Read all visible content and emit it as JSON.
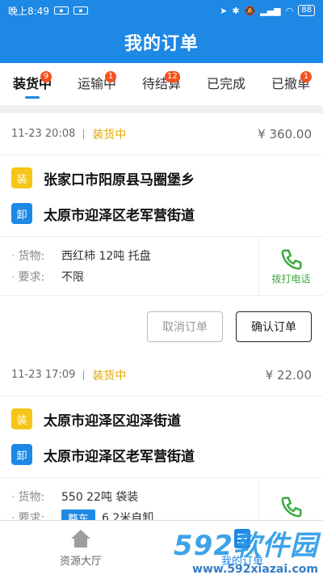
{
  "statusbar": {
    "time": "晚上8:49",
    "battery": "88"
  },
  "header": {
    "title": "我的订单"
  },
  "tabs": [
    {
      "label": "装货中",
      "badge": "9",
      "active": true
    },
    {
      "label": "运输中",
      "badge": "1",
      "active": false
    },
    {
      "label": "待结算",
      "badge": "12",
      "active": false
    },
    {
      "label": "已完成",
      "badge": "",
      "active": false
    },
    {
      "label": "已撤单",
      "badge": "1",
      "active": false
    }
  ],
  "orders": [
    {
      "datetime": "11-23 20:08",
      "state": "装货中",
      "price": "¥ 360.00",
      "load_tag": "装",
      "load_address": "张家口市阳原县马圈堡乡",
      "unload_tag": "卸",
      "unload_address": "太原市迎泽区老军营街道",
      "cargo_label": "货物:",
      "cargo": "西红柿 12吨 托盘",
      "req_label": "要求:",
      "requirement": "不限",
      "call_label": "拨打电话",
      "cancel_label": "取消订单",
      "confirm_label": "确认订单"
    },
    {
      "datetime": "11-23 17:09",
      "state": "装货中",
      "price": "¥ 22.00",
      "load_tag": "装",
      "load_address": "太原市迎泽区迎泽街道",
      "unload_tag": "卸",
      "unload_address": "太原市迎泽区老军营街道",
      "cargo_label": "货物:",
      "cargo": "550 22吨 袋装",
      "req_label": "要求:",
      "req_chip": "整车",
      "requirement": "6.2米自卸"
    }
  ],
  "bottom_nav": [
    {
      "label": "资源大厅",
      "icon": "home-icon"
    },
    {
      "label": "我的订单",
      "icon": "orders-icon"
    }
  ],
  "watermark": {
    "brand": "592软件园",
    "url": "www.592xiazai.com"
  },
  "colors": {
    "primary": "#1e88e5",
    "badge": "#f4511e",
    "state": "#e0a800",
    "call": "#3caa3c",
    "load_tag": "#f5c518"
  }
}
